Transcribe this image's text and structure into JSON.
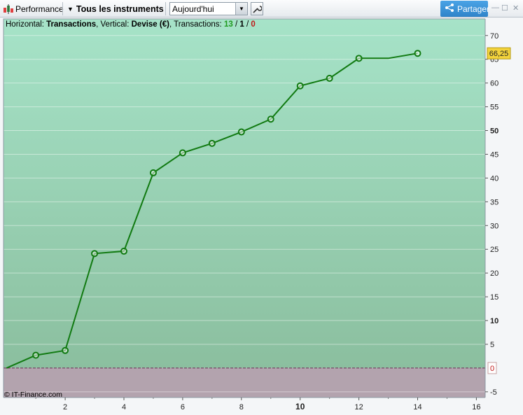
{
  "toolbar": {
    "title": "Performance",
    "instruments_label": "Tous les instruments",
    "period_value": "Aujourd'hui",
    "share_label": "Partager",
    "minimize_symbol": "—",
    "maximize_symbol": "☐",
    "close_symbol": "✕"
  },
  "chart_header": {
    "prefix1": "Horizontal: ",
    "horizontal": "Transactions",
    "prefix2": ", Vertical: ",
    "vertical": "Devise (€)",
    "prefix3": ", Transactions: ",
    "tx_total": "13",
    "slash1": " / ",
    "tx_mid": "1",
    "slash2": " / ",
    "tx_losses": "0"
  },
  "copyright": "© IT-Finance.com",
  "last_value_label": "66,25",
  "zero_label": "0",
  "colors": {
    "line": "#117a11",
    "top_fill": "#a6e3c8",
    "bottom_fill": "#8bbf9f",
    "negative_fill": "#b3a3ae",
    "value_badge": "#f3d33c",
    "accent": "#2f84c9"
  },
  "chart_data": {
    "type": "line",
    "x": [
      0,
      1,
      2,
      3,
      4,
      5,
      6,
      7,
      8,
      9,
      10,
      11,
      12,
      13,
      14
    ],
    "y": [
      0,
      2.7,
      3.7,
      24.1,
      24.6,
      41.1,
      45.3,
      47.3,
      49.7,
      52.4,
      59.4,
      61,
      65.2,
      65.2,
      66.25
    ],
    "markers": [
      false,
      true,
      true,
      true,
      true,
      true,
      true,
      true,
      true,
      true,
      true,
      true,
      true,
      false,
      true
    ],
    "xlim": [
      -0.1,
      16.3
    ],
    "ylim": [
      -6.2,
      73.5
    ],
    "xticks": [
      2,
      4,
      6,
      8,
      10,
      12,
      14,
      16
    ],
    "xtick_labels": [
      "2",
      "4",
      "6",
      "8",
      "10",
      "12",
      "14",
      "16"
    ],
    "yticks": [
      -5,
      5,
      10,
      15,
      20,
      25,
      30,
      35,
      40,
      45,
      50,
      55,
      60,
      65,
      70
    ],
    "ytick_labels": [
      "-5",
      "5",
      "10",
      "15",
      "20",
      "25",
      "30",
      "35",
      "40",
      "45",
      "50",
      "55",
      "60",
      "65",
      "70"
    ],
    "bold_ticks": [
      "10",
      "50"
    ],
    "grid": true
  }
}
